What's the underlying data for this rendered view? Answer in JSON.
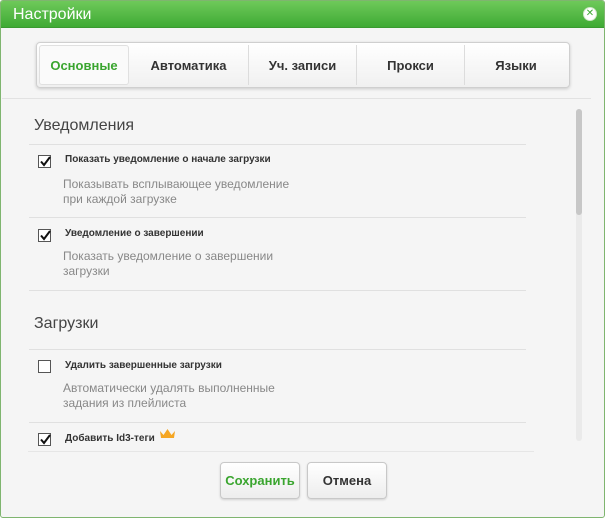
{
  "window": {
    "title": "Настройки"
  },
  "tabs": [
    {
      "label": "Основные",
      "active": true
    },
    {
      "label": "Автоматика",
      "active": false
    },
    {
      "label": "Уч. записи",
      "active": false
    },
    {
      "label": "Прокси",
      "active": false
    },
    {
      "label": "Языки",
      "active": false
    }
  ],
  "sections": [
    {
      "title": "Уведомления",
      "options": [
        {
          "label": "Показать уведомление о начале загрузки",
          "checked": true,
          "description": [
            "Показывать всплывающее уведомление",
            "при каждой загрузке"
          ]
        },
        {
          "label": "Уведомление о завершении",
          "checked": true,
          "description": [
            "Показать уведомление о завершении",
            "загрузки"
          ]
        }
      ]
    },
    {
      "title": "Загрузки",
      "options": [
        {
          "label": "Удалить завершенные загрузки",
          "checked": false,
          "description": [
            "Автоматически удалять выполненные",
            "задания из плейлиста"
          ]
        },
        {
          "label": "Добавить Id3-теги",
          "checked": true,
          "badge_icon": "crown-icon"
        }
      ]
    }
  ],
  "footer": {
    "save_label": "Сохранить",
    "cancel_label": "Отмена"
  },
  "colors": {
    "accent": "#3aa52f",
    "titlebar": "#4db542",
    "crown": "#f5a623"
  }
}
